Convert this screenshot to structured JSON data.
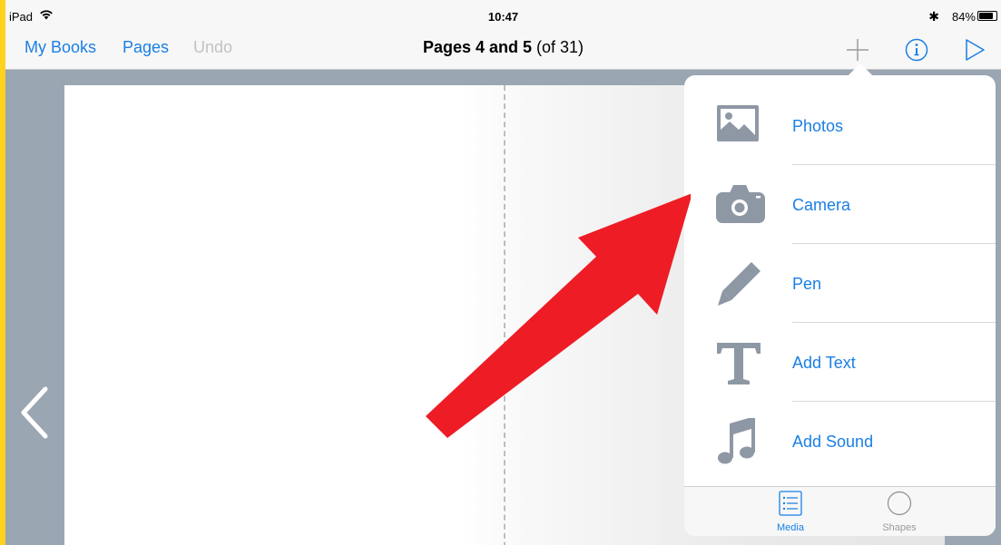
{
  "status_bar": {
    "device": "iPad",
    "time": "10:47",
    "battery": "84%",
    "battery_level": 0.84
  },
  "nav": {
    "my_books": "My Books",
    "pages": "Pages",
    "undo": "Undo",
    "title_bold": "Pages 4 and 5",
    "title_suffix": "(of 31)",
    "icons": [
      "plus-icon",
      "info-icon",
      "play-icon"
    ]
  },
  "popover": {
    "items": [
      {
        "label": "Photos",
        "icon": "photos-icon"
      },
      {
        "label": "Camera",
        "icon": "camera-icon"
      },
      {
        "label": "Pen",
        "icon": "pen-icon"
      },
      {
        "label": "Add Text",
        "icon": "text-icon"
      },
      {
        "label": "Add Sound",
        "icon": "music-note-icon"
      }
    ],
    "tabs": [
      {
        "label": "Media",
        "selected": true
      },
      {
        "label": "Shapes",
        "selected": false
      }
    ]
  },
  "colors": {
    "accent": "#1A7FE4",
    "border_highlight": "#FFD21F",
    "annotation_arrow": "#EE1C25",
    "icon_gray": "#8E98A5"
  }
}
